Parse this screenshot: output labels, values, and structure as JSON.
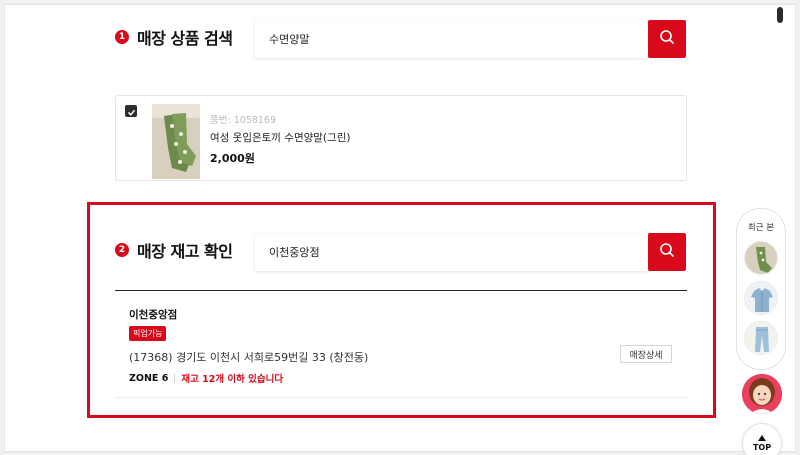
{
  "section1": {
    "number": "1",
    "title": "매장 상품 검색",
    "search_value": "수면양말"
  },
  "product": {
    "checked": true,
    "code": "품번: 1058169",
    "name": "여성 옷입은토끼 수면양말(그린)",
    "price": "2,000원"
  },
  "section2": {
    "number": "2",
    "title": "매장 재고 확인",
    "search_value": "이천중앙점"
  },
  "store": {
    "name": "이천중앙점",
    "badge": "픽업가능",
    "address": "(17368) 경기도 이천시 서희로59번길 33 (창전동)",
    "zone": "ZONE 6",
    "stock": "재고 12개 이하 있습니다",
    "detail_label": "매장상세"
  },
  "sidebar": {
    "recent_title": "최근 본",
    "recent_items": [
      "green-sock-icon",
      "denim-shirt-icon",
      "jeans-icon"
    ],
    "top_label": "TOP"
  },
  "colors": {
    "accent": "#d8091a",
    "dark": "#2d2d2d"
  }
}
